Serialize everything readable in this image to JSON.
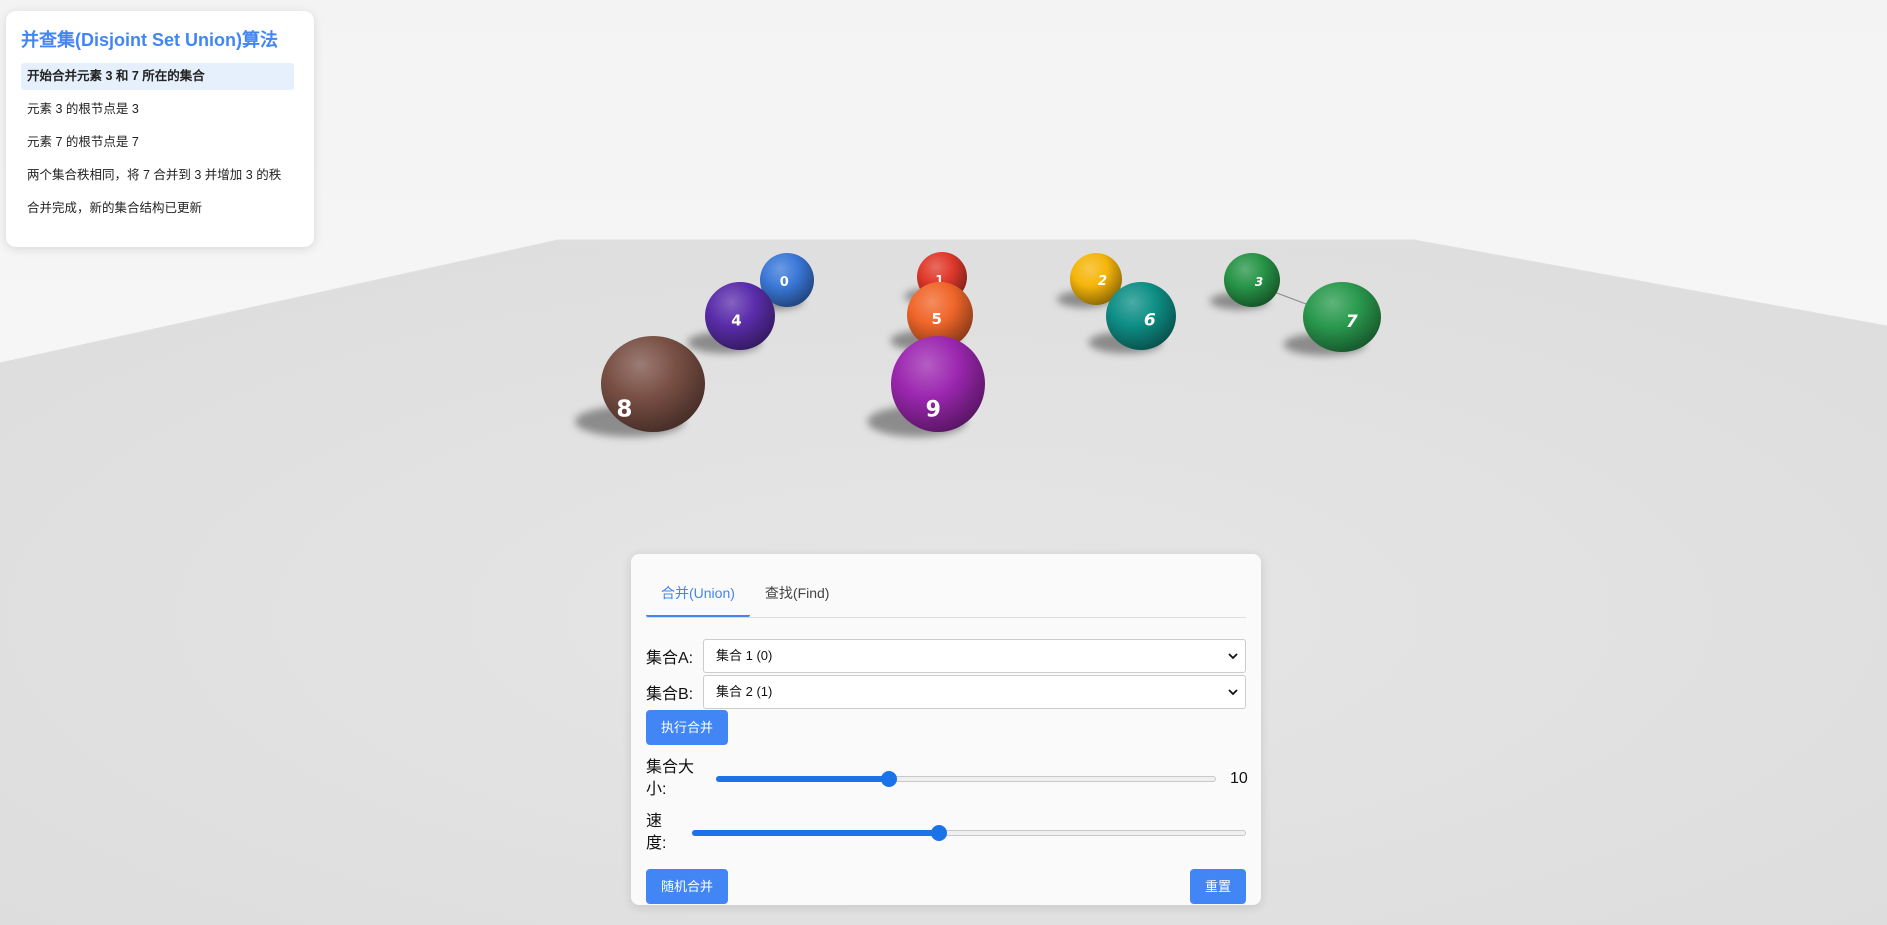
{
  "info_panel": {
    "title": "并查集(Disjoint Set Union)算法",
    "steps": [
      "开始合并元素 3 和 7 所在的集合",
      "元素 3 的根节点是 3",
      "元素 7 的根节点是 7",
      "两个集合秩相同，将 7 合并到 3 并增加 3 的秩",
      "合并完成，新的集合结构已更新"
    ]
  },
  "scene": {
    "spheres": [
      {
        "label": "0",
        "color": "#3a78d8"
      },
      {
        "label": "4",
        "color": "#5b2dab"
      },
      {
        "label": "8",
        "color": "#7a5045"
      },
      {
        "label": "1",
        "color": "#e0392b"
      },
      {
        "label": "5",
        "color": "#f0662a"
      },
      {
        "label": "9",
        "color": "#9c27b0"
      },
      {
        "label": "2",
        "color": "#f5b50a"
      },
      {
        "label": "6",
        "color": "#0e8f86"
      },
      {
        "label": "3",
        "color": "#279447"
      },
      {
        "label": "7",
        "color": "#2a9a4e"
      }
    ],
    "links": [
      [
        "3",
        "7"
      ]
    ]
  },
  "controls": {
    "tabs": [
      {
        "label": "合并(Union)",
        "active": true
      },
      {
        "label": "查找(Find)",
        "active": false
      }
    ],
    "set_a_label": "集合A:",
    "set_a_value": "集合 1 (0)",
    "set_b_label": "集合B:",
    "set_b_value": "集合 2 (1)",
    "merge_button": "执行合并",
    "size_label": "集合大小:",
    "size_value": "10",
    "size_fraction": 0.346,
    "speed_label": "速度:",
    "speed_fraction": 0.446,
    "random_button": "随机合并",
    "reset_button": "重置"
  },
  "colors": {
    "accent": "#4285f4",
    "slider": "#1a73e8"
  }
}
